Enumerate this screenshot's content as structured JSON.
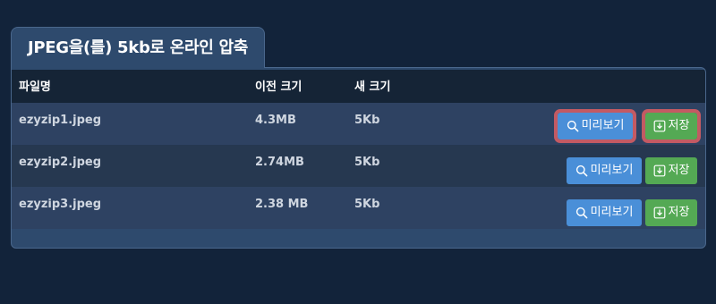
{
  "tab": {
    "title": "JPEG을(를) 5kb로 온라인 압축"
  },
  "table": {
    "headers": {
      "name": "파일명",
      "before": "이전 크기",
      "after": "새 크기"
    },
    "rows": [
      {
        "name": "ezyzip1.jpeg",
        "before": "4.3MB",
        "after": "5Kb",
        "preview": "미리보기",
        "save": "저장"
      },
      {
        "name": "ezyzip2.jpeg",
        "before": "2.74MB",
        "after": "5Kb",
        "preview": "미리보기",
        "save": "저장"
      },
      {
        "name": "ezyzip3.jpeg",
        "before": "2.38 MB",
        "after": "5Kb",
        "preview": "미리보기",
        "save": "저장"
      }
    ]
  },
  "icons": {
    "preview": "search-icon",
    "save": "download-icon"
  },
  "colors": {
    "background": "#12233a",
    "panel": "#2e4a6d",
    "preview_button": "#4a8fd8",
    "save_button": "#54a954",
    "highlight": "#c35a63"
  }
}
